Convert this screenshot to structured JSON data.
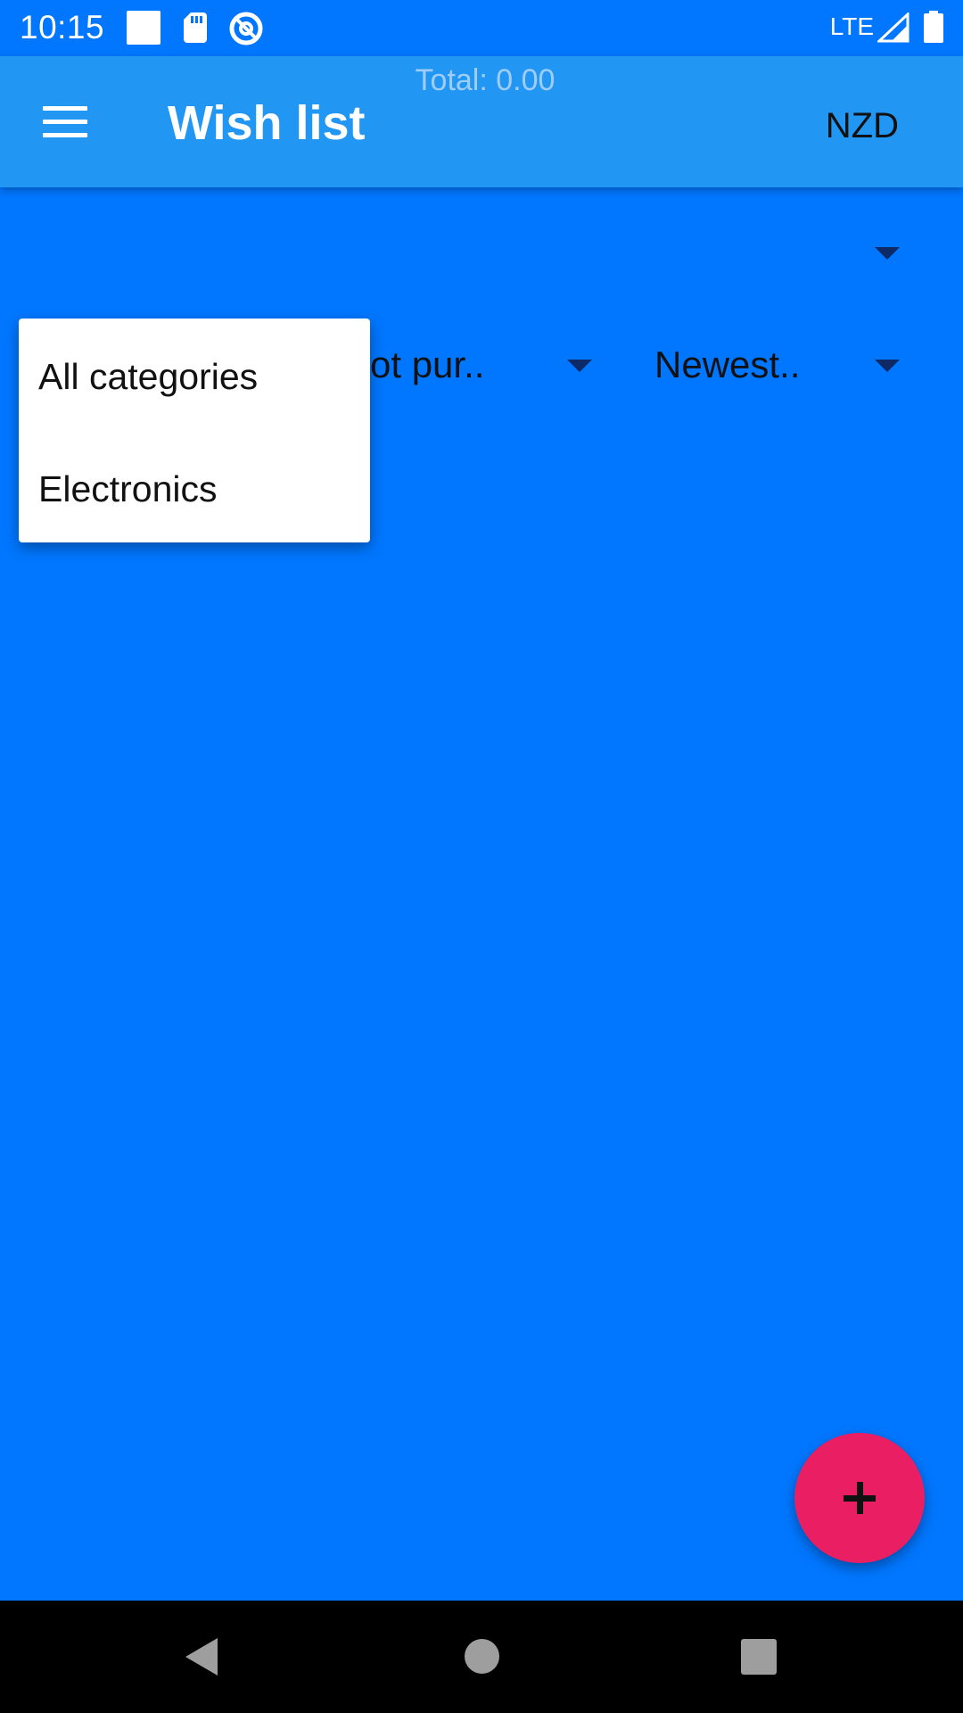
{
  "status_bar": {
    "time": "10:15",
    "network": "LTE",
    "icons": [
      "square-notification-icon",
      "sd-card-icon",
      "at-sign-icon",
      "signal-icon",
      "battery-icon"
    ]
  },
  "app_bar": {
    "title": "Wish list",
    "total": "Total: 0.00",
    "currency": "NZD",
    "background": "#2196F3"
  },
  "filters": {
    "status_value": "ot pur..",
    "sort_value": "Newest.."
  },
  "category_popup": {
    "items": [
      "All categories",
      "Electronics"
    ]
  },
  "fab": {
    "icon": "plus-icon",
    "color": "#E91E63"
  },
  "colors": {
    "background": "#0177FF"
  }
}
